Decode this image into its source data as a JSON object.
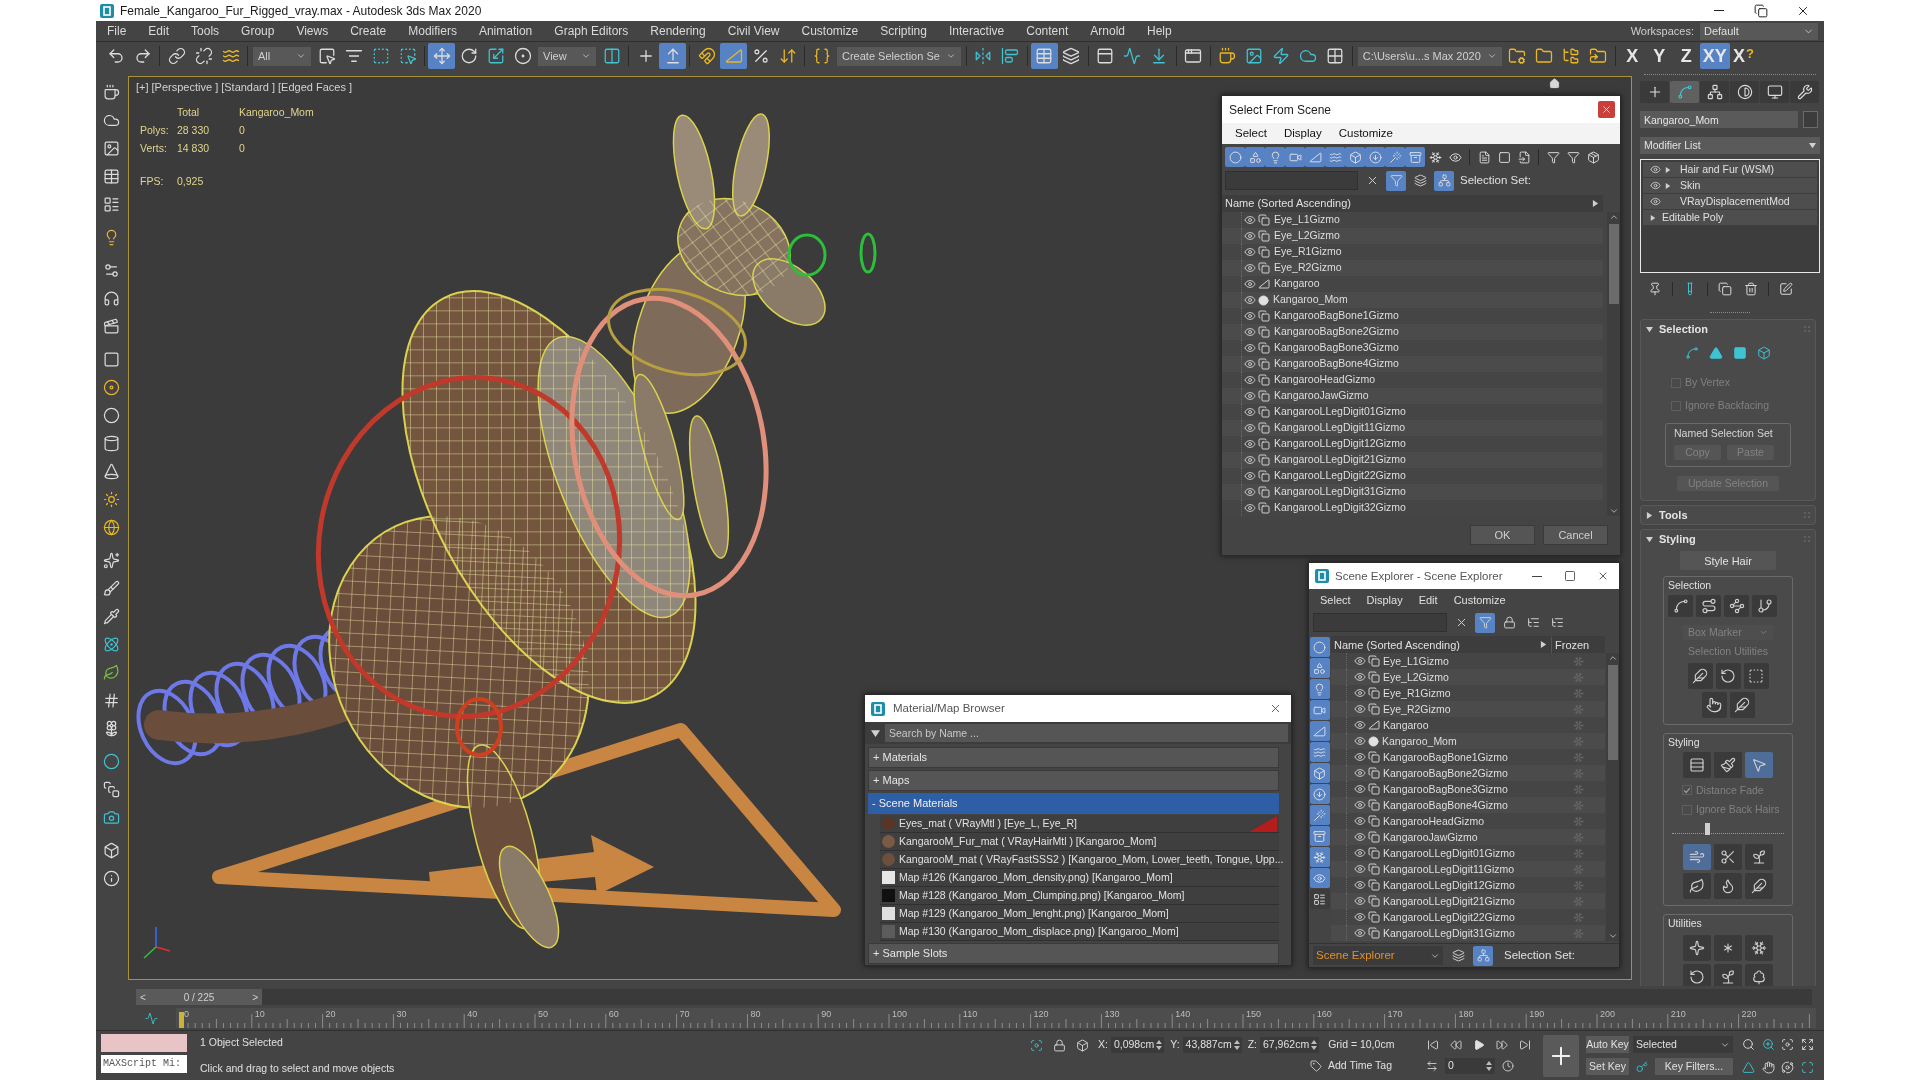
{
  "window": {
    "title": "Female_Kangaroo_Fur_Rigged_vray.max - Autodesk 3ds Max 2020"
  },
  "menu": [
    "File",
    "Edit",
    "Tools",
    "Group",
    "Views",
    "Create",
    "Modifiers",
    "Animation",
    "Graph Editors",
    "Rendering",
    "Civil View",
    "Customize",
    "Scripting",
    "Interactive",
    "Content",
    "Arnold",
    "Help"
  ],
  "workspaces": {
    "label": "Workspaces:",
    "value": "Default"
  },
  "toolbar": [
    {
      "kind": "button",
      "selected": false
    },
    {
      "kind": "button",
      "selected": false
    },
    {
      "kind": "separator"
    },
    {
      "kind": "button",
      "selected": false
    },
    {
      "kind": "button",
      "selected": false
    },
    {
      "kind": "button",
      "selected": false
    },
    {
      "kind": "separator"
    },
    {
      "kind": "dropdown",
      "value": "All"
    },
    {
      "kind": "button",
      "selected": false
    },
    {
      "kind": "button",
      "selected": false
    },
    {
      "kind": "button",
      "selected": false
    },
    {
      "kind": "button",
      "selected": false
    },
    {
      "kind": "separator"
    },
    {
      "kind": "button",
      "selected": true
    },
    {
      "kind": "button",
      "selected": false
    },
    {
      "kind": "button",
      "selected": false
    },
    {
      "kind": "button",
      "selected": false
    },
    {
      "kind": "dropdown",
      "value": "View"
    },
    {
      "kind": "button",
      "selected": false
    },
    {
      "kind": "separator"
    },
    {
      "kind": "button",
      "selected": false
    },
    {
      "kind": "button",
      "selected": true
    },
    {
      "kind": "separator"
    },
    {
      "kind": "button",
      "selected": false
    },
    {
      "kind": "button",
      "selected": true
    },
    {
      "kind": "button",
      "selected": false
    },
    {
      "kind": "button",
      "selected": false
    },
    {
      "kind": "separator"
    },
    {
      "kind": "button",
      "selected": false
    },
    {
      "kind": "dropdown",
      "value": "Create Selection Se"
    },
    {
      "kind": "separator"
    },
    {
      "kind": "button",
      "selected": false
    },
    {
      "kind": "button",
      "selected": false
    },
    {
      "kind": "separator"
    },
    {
      "kind": "button",
      "selected": true
    },
    {
      "kind": "button",
      "selected": false
    },
    {
      "kind": "separator"
    },
    {
      "kind": "button",
      "selected": false
    },
    {
      "kind": "button",
      "selected": false
    },
    {
      "kind": "button",
      "selected": false
    },
    {
      "kind": "separator"
    },
    {
      "kind": "button",
      "selected": false
    },
    {
      "kind": "separator"
    },
    {
      "kind": "button",
      "selected": false
    },
    {
      "kind": "button",
      "selected": false
    },
    {
      "kind": "button",
      "selected": false
    },
    {
      "kind": "button",
      "selected": false
    },
    {
      "kind": "button",
      "selected": false
    },
    {
      "kind": "separator"
    },
    {
      "kind": "dropdown",
      "value": "C:\\Users\\u...s Max 2020"
    },
    {
      "kind": "button",
      "selected": false
    },
    {
      "kind": "button",
      "selected": false
    },
    {
      "kind": "button",
      "selected": false
    },
    {
      "kind": "button",
      "selected": false
    },
    {
      "kind": "separator"
    },
    {
      "kind": "axis",
      "label": "X",
      "selected": false
    },
    {
      "kind": "axis",
      "label": "Y",
      "selected": false
    },
    {
      "kind": "axis",
      "label": "Z",
      "selected": false
    },
    {
      "kind": "axis",
      "label": "XY",
      "selected": true
    },
    {
      "kind": "axis",
      "label": "X",
      "badge": "?",
      "selected": false
    }
  ],
  "viewport": {
    "labels": [
      "[+]",
      "[Perspective ]",
      "[Standard ]",
      "[Edged Faces ]"
    ],
    "stats": {
      "columns": [
        "Total",
        "Kangaroo_Mom"
      ],
      "rows": [
        {
          "label": "Polys:",
          "values": [
            "28 330",
            "0"
          ]
        },
        {
          "label": "Verts:",
          "values": [
            "14 830",
            "0"
          ]
        }
      ],
      "fps": {
        "label": "FPS:",
        "value": "0,925"
      }
    }
  },
  "command_panel": {
    "tabs": [
      {
        "selected": false
      },
      {
        "selected": true
      },
      {
        "selected": false
      },
      {
        "selected": false
      },
      {
        "selected": false
      },
      {
        "selected": false
      }
    ],
    "object_name": "Kangaroo_Mom",
    "modifier_list": "Modifier List",
    "stack": [
      {
        "name": "Hair and Fur (WSM)",
        "kind": "modifier",
        "expandable": true
      },
      {
        "name": "Skin",
        "kind": "modifier",
        "expandable": true
      },
      {
        "name": "VRayDisplacementMod",
        "kind": "modifier",
        "expandable": false
      },
      {
        "name": "Editable Poly",
        "kind": "base",
        "expandable": true
      }
    ],
    "rollouts": [
      {
        "kind": "selection",
        "title": "Selection",
        "expanded": true,
        "modes": [
          {
            "selected": false
          },
          {
            "selected": false
          },
          {
            "selected": false
          },
          {
            "selected": false
          }
        ],
        "checkboxes": [
          {
            "label": "By Vertex",
            "checked": false,
            "disabled": true
          },
          {
            "label": "Ignore Backfacing",
            "checked": false,
            "disabled": true
          }
        ],
        "group": {
          "title": "Named Selection Set",
          "buttons": [
            {
              "label": "Copy",
              "disabled": true
            },
            {
              "label": "Paste",
              "disabled": true
            }
          ]
        },
        "button": {
          "label": "Update Selection",
          "disabled": true
        }
      },
      {
        "kind": "tools",
        "title": "Tools",
        "expanded": false
      },
      {
        "kind": "styling",
        "title": "Styling",
        "expanded": true,
        "button": {
          "label": "Style Hair",
          "disabled": false
        },
        "selection": {
          "title": "Selection",
          "modes": [
            {
              "selected": false
            },
            {
              "selected": false
            },
            {
              "selected": false
            },
            {
              "selected": false
            }
          ],
          "dropdown": {
            "value": "Box Marker",
            "disabled": true
          },
          "utilities_label": "Selection Utilities"
        },
        "styling": {
          "title": "Styling",
          "tools": [
            {
              "selected": false
            },
            {
              "selected": false
            },
            {
              "selected": true
            }
          ],
          "checkboxes": [
            {
              "label": "Distance Fade",
              "checked": true,
              "disabled": true
            },
            {
              "label": "Ignore Back Hairs",
              "checked": false,
              "disabled": true
            }
          ],
          "slider": {
            "level": 0.31
          },
          "brushes": [
            {
              "selected": true
            },
            {
              "selected": false
            },
            {
              "selected": false
            },
            {
              "selected": false
            },
            {
              "selected": false
            },
            {
              "selected": false
            }
          ]
        },
        "utilities": {
          "title": "Utilities"
        }
      }
    ]
  },
  "select_from_scene": {
    "title": "Select From Scene",
    "menu": [
      "Select",
      "Display",
      "Customize"
    ],
    "filters": [
      {
        "selected": true
      },
      {
        "selected": true
      },
      {
        "selected": true
      },
      {
        "selected": true
      },
      {
        "selected": true
      },
      {
        "selected": true
      },
      {
        "selected": true
      },
      {
        "selected": true
      },
      {
        "selected": true
      },
      {
        "selected": true
      },
      {
        "selected": false
      },
      {
        "selected": false
      },
      {
        "selected": false
      },
      {
        "selected": false
      },
      {
        "selected": false
      },
      {
        "selected": false
      },
      {
        "selected": false
      },
      {
        "selected": false
      }
    ],
    "search_tools": [
      {
        "selected": false
      },
      {
        "selected": true
      },
      {
        "selected": false
      },
      {
        "selected": true
      }
    ],
    "selection_set_label": "Selection Set:",
    "column": "Name (Sorted Ascending)",
    "rows": [
      {
        "name": "Eye_L1Gizmo",
        "kind": "gizmo",
        "selected": false
      },
      {
        "name": "Eye_L2Gizmo",
        "kind": "gizmo",
        "selected": false
      },
      {
        "name": "Eye_R1Gizmo",
        "kind": "gizmo",
        "selected": false
      },
      {
        "name": "Eye_R2Gizmo",
        "kind": "gizmo",
        "selected": false
      },
      {
        "name": "Kangaroo",
        "kind": "bone",
        "selected": false
      },
      {
        "name": "Kangaroo_Mom",
        "kind": "geometry",
        "selected": false
      },
      {
        "name": "KangarooBagBone1Gizmo",
        "kind": "gizmo",
        "selected": false
      },
      {
        "name": "KangarooBagBone2Gizmo",
        "kind": "gizmo",
        "selected": false
      },
      {
        "name": "KangarooBagBone3Gizmo",
        "kind": "gizmo",
        "selected": false
      },
      {
        "name": "KangarooBagBone4Gizmo",
        "kind": "gizmo",
        "selected": false
      },
      {
        "name": "KangarooHeadGizmo",
        "kind": "gizmo",
        "selected": false
      },
      {
        "name": "KangarooJawGizmo",
        "kind": "gizmo",
        "selected": false
      },
      {
        "name": "KangarooLLegDigit01Gizmo",
        "kind": "gizmo",
        "selected": false
      },
      {
        "name": "KangarooLLegDigit11Gizmo",
        "kind": "gizmo",
        "selected": false
      },
      {
        "name": "KangarooLLegDigit12Gizmo",
        "kind": "gizmo",
        "selected": false
      },
      {
        "name": "KangarooLLegDigit21Gizmo",
        "kind": "gizmo",
        "selected": false
      },
      {
        "name": "KangarooLLegDigit22Gizmo",
        "kind": "gizmo",
        "selected": false
      },
      {
        "name": "KangarooLLegDigit31Gizmo",
        "kind": "gizmo",
        "selected": false
      },
      {
        "name": "KangarooLLegDigit32Gizmo",
        "kind": "gizmo",
        "selected": false
      }
    ],
    "buttons": [
      "OK",
      "Cancel"
    ]
  },
  "scene_explorer": {
    "title": "Scene Explorer - Scene Explorer",
    "menu": [
      "Select",
      "Display",
      "Edit",
      "Customize"
    ],
    "search_tools": [
      {
        "selected": false
      },
      {
        "selected": true
      },
      {
        "selected": false
      },
      {
        "selected": false
      },
      {
        "selected": false
      }
    ],
    "filters": [
      {
        "selected": true
      },
      {
        "selected": true
      },
      {
        "selected": true
      },
      {
        "selected": true
      },
      {
        "selected": true
      },
      {
        "selected": true
      },
      {
        "selected": true
      },
      {
        "selected": true
      },
      {
        "selected": true
      },
      {
        "selected": true
      },
      {
        "selected": true
      },
      {
        "selected": true
      },
      {
        "selected": false
      }
    ],
    "columns": [
      "Name (Sorted Ascending)",
      "Frozen"
    ],
    "rows": [
      {
        "name": "Eye_L1Gizmo",
        "kind": "gizmo",
        "selected": false,
        "frozen": false
      },
      {
        "name": "Eye_L2Gizmo",
        "kind": "gizmo",
        "selected": false,
        "frozen": false
      },
      {
        "name": "Eye_R1Gizmo",
        "kind": "gizmo",
        "selected": false,
        "frozen": false
      },
      {
        "name": "Eye_R2Gizmo",
        "kind": "gizmo",
        "selected": false,
        "frozen": false
      },
      {
        "name": "Kangaroo",
        "kind": "bone",
        "selected": false,
        "frozen": false
      },
      {
        "name": "Kangaroo_Mom",
        "kind": "geometry",
        "selected": false,
        "frozen": false
      },
      {
        "name": "KangarooBagBone1Gizmo",
        "kind": "gizmo",
        "selected": false,
        "frozen": false
      },
      {
        "name": "KangarooBagBone2Gizmo",
        "kind": "gizmo",
        "selected": false,
        "frozen": false
      },
      {
        "name": "KangarooBagBone3Gizmo",
        "kind": "gizmo",
        "selected": false,
        "frozen": false
      },
      {
        "name": "KangarooBagBone4Gizmo",
        "kind": "gizmo",
        "selected": false,
        "frozen": false
      },
      {
        "name": "KangarooHeadGizmo",
        "kind": "gizmo",
        "selected": false,
        "frozen": false
      },
      {
        "name": "KangarooJawGizmo",
        "kind": "gizmo",
        "selected": false,
        "frozen": false
      },
      {
        "name": "KangarooLLegDigit01Gizmo",
        "kind": "gizmo",
        "selected": false,
        "frozen": false
      },
      {
        "name": "KangarooLLegDigit11Gizmo",
        "kind": "gizmo",
        "selected": false,
        "frozen": false
      },
      {
        "name": "KangarooLLegDigit12Gizmo",
        "kind": "gizmo",
        "selected": false,
        "frozen": false
      },
      {
        "name": "KangarooLLegDigit21Gizmo",
        "kind": "gizmo",
        "selected": false,
        "frozen": false
      },
      {
        "name": "KangarooLLegDigit22Gizmo",
        "kind": "gizmo",
        "selected": false,
        "frozen": false
      },
      {
        "name": "KangarooLLegDigit31Gizmo",
        "kind": "gizmo",
        "selected": false,
        "frozen": false
      }
    ],
    "explorer": "Scene Explorer",
    "bottom_tools": [
      {
        "selected": false
      },
      {
        "selected": true
      }
    ],
    "selection_set_label": "Selection Set:"
  },
  "material_browser": {
    "title": "Material/Map Browser",
    "search": {
      "placeholder": "Search by Name ..."
    },
    "groups": [
      {
        "sign": "+",
        "label": "Materials",
        "expanded": false
      },
      {
        "sign": "+",
        "label": "Maps",
        "expanded": false
      },
      {
        "sign": "-",
        "label": "Scene Materials",
        "expanded": true,
        "items": [
          {
            "label": "Eyes_mat ( VRayMtl ) [Eye_L, Eye_R]",
            "kind": "material",
            "color": "#5a3526",
            "marked": true
          },
          {
            "label": "KangarooM_Fur_mat ( VRayHairMtl ) [Kangaroo_Mom]",
            "kind": "material",
            "color": "#7a5a44",
            "marked": false
          },
          {
            "label": "KangarooM_mat ( VRayFastSSS2 ) [Kangaroo_Mom, Lower_teeth, Tongue, Upp...",
            "kind": "material",
            "color": "#6e4f3d",
            "marked": false
          },
          {
            "label": "Map #126 (Kangaroo_Mom_density.png) [Kangaroo_Mom]",
            "kind": "map",
            "color": "#e6e6e6",
            "marked": false
          },
          {
            "label": "Map #128 (Kangaroo_Mom_Clumping.png) [Kangaroo_Mom]",
            "kind": "map",
            "color": "#101010",
            "marked": false
          },
          {
            "label": "Map #129 (Kangaroo_Mom_lenght.png) [Kangaroo_Mom]",
            "kind": "map",
            "color": "#dedede",
            "marked": false
          },
          {
            "label": "Map #130 (Kangaroo_Mom_displace.png) [Kangaroo_Mom]",
            "kind": "map",
            "color": "#5c5c5c",
            "marked": false
          }
        ]
      },
      {
        "sign": "+",
        "label": "Sample Slots",
        "expanded": false
      }
    ]
  },
  "timeline": {
    "prev": "<",
    "position": "0 / 225",
    "next": ">",
    "level": 0,
    "ticks": [
      "0",
      "10",
      "20",
      "30",
      "40",
      "50",
      "60",
      "70",
      "80",
      "90",
      "100",
      "110",
      "120",
      "130",
      "140",
      "150",
      "160",
      "170",
      "180",
      "190",
      "200",
      "210",
      "220"
    ]
  },
  "status_bar": {
    "maxscript": "MAXScript Mi:",
    "selection": "1 Object Selected",
    "prompt": "Click and drag to select and move objects",
    "coords": [
      {
        "axis": "X:",
        "value": "0,098cm"
      },
      {
        "axis": "Y:",
        "value": "43,887cm"
      },
      {
        "axis": "Z:",
        "value": "67,962cm"
      }
    ],
    "grid": "Grid = 10,0cm",
    "time_tag": "Add Time Tag",
    "frame": "0",
    "auto_key": "Auto Key",
    "key_mode": "Selected",
    "set_key": "Set Key",
    "key_filters": "Key Filters..."
  }
}
